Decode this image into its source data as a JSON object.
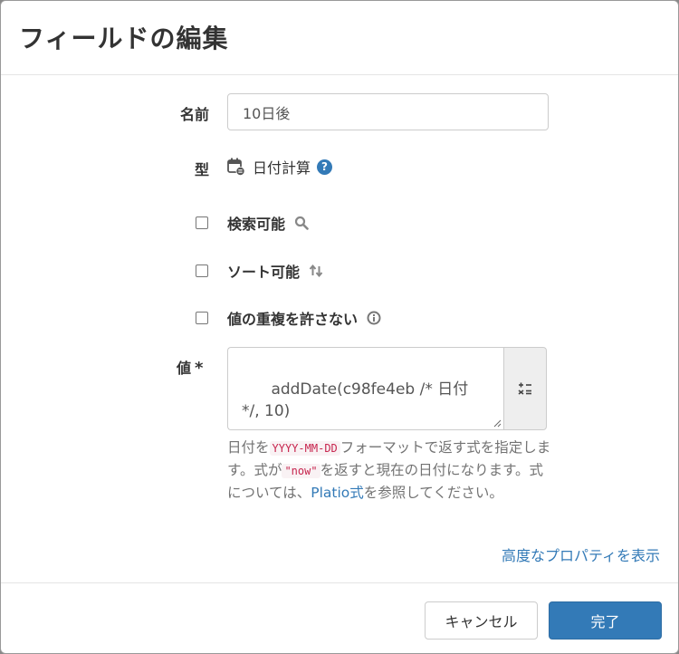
{
  "dialog": {
    "title": "フィールドの編集"
  },
  "fields": {
    "name": {
      "label": "名前",
      "value": "10日後"
    },
    "type": {
      "label": "型",
      "value": "日付計算",
      "icon": "calendar-calc-icon",
      "help": "?"
    },
    "searchable": {
      "label": "検索可能",
      "checked": false,
      "icon": "search-icon"
    },
    "sortable": {
      "label": "ソート可能",
      "checked": false,
      "icon": "sort-icon"
    },
    "unique": {
      "label": "値の重複を許さない",
      "checked": false,
      "icon": "info-icon"
    },
    "value": {
      "label": "値",
      "required_mark": "*",
      "text": "addDate(c98fe4eb /* 日付 */, 10)",
      "help": {
        "part1": "日付を",
        "code1": "YYYY-MM-DD",
        "part2": "フォーマットで返す式を指定します。式が",
        "code2": "\"now\"",
        "part3": "を返すと現在の日付になります。式については、",
        "link": "Platio式",
        "part4": "を参照してください。"
      }
    }
  },
  "advanced_link": "高度なプロパティを表示",
  "footer": {
    "cancel": "キャンセル",
    "ok": "完了"
  },
  "colors": {
    "primary": "#337ab7",
    "code": "#c7254e"
  }
}
